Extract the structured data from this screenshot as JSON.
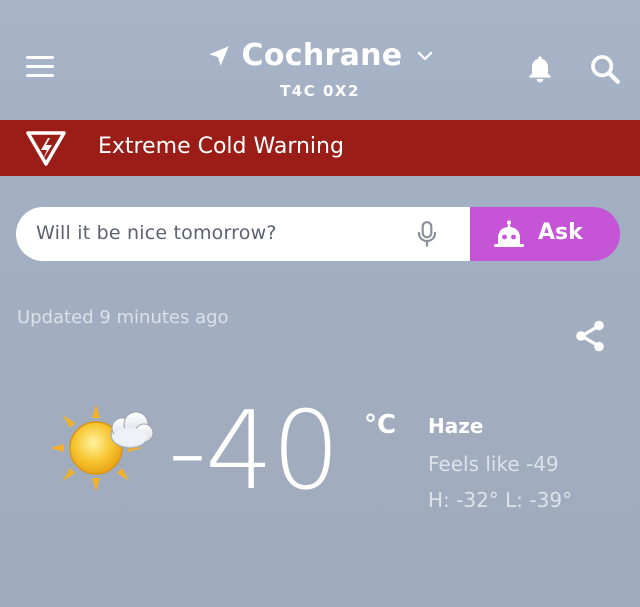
{
  "header": {
    "city": "Cochrane",
    "postal_code": "T4C 0X2",
    "icons": {
      "menu": "hamburger-menu-icon",
      "location": "location-arrow-icon",
      "dropdown": "chevron-down-icon",
      "notifications": "bell-icon",
      "search": "search-icon"
    }
  },
  "alert": {
    "label": "Extreme Cold Warning",
    "icon": "warning-triangle-icon",
    "color": "#9a1e17"
  },
  "ask": {
    "placeholder": "Will it be nice tomorrow?",
    "button_label": "Ask",
    "mic_icon": "microphone-icon",
    "bot_icon": "robot-icon",
    "button_color": "#c554d6"
  },
  "current": {
    "updated": "Updated 9 minutes ago",
    "share_icon": "share-icon",
    "condition_icon": "sun-with-cloud-icon",
    "temperature": "-40",
    "unit": "°C",
    "condition": "Haze",
    "feels_like": "Feels like -49",
    "high_low": "H: -32° L: -39°"
  }
}
